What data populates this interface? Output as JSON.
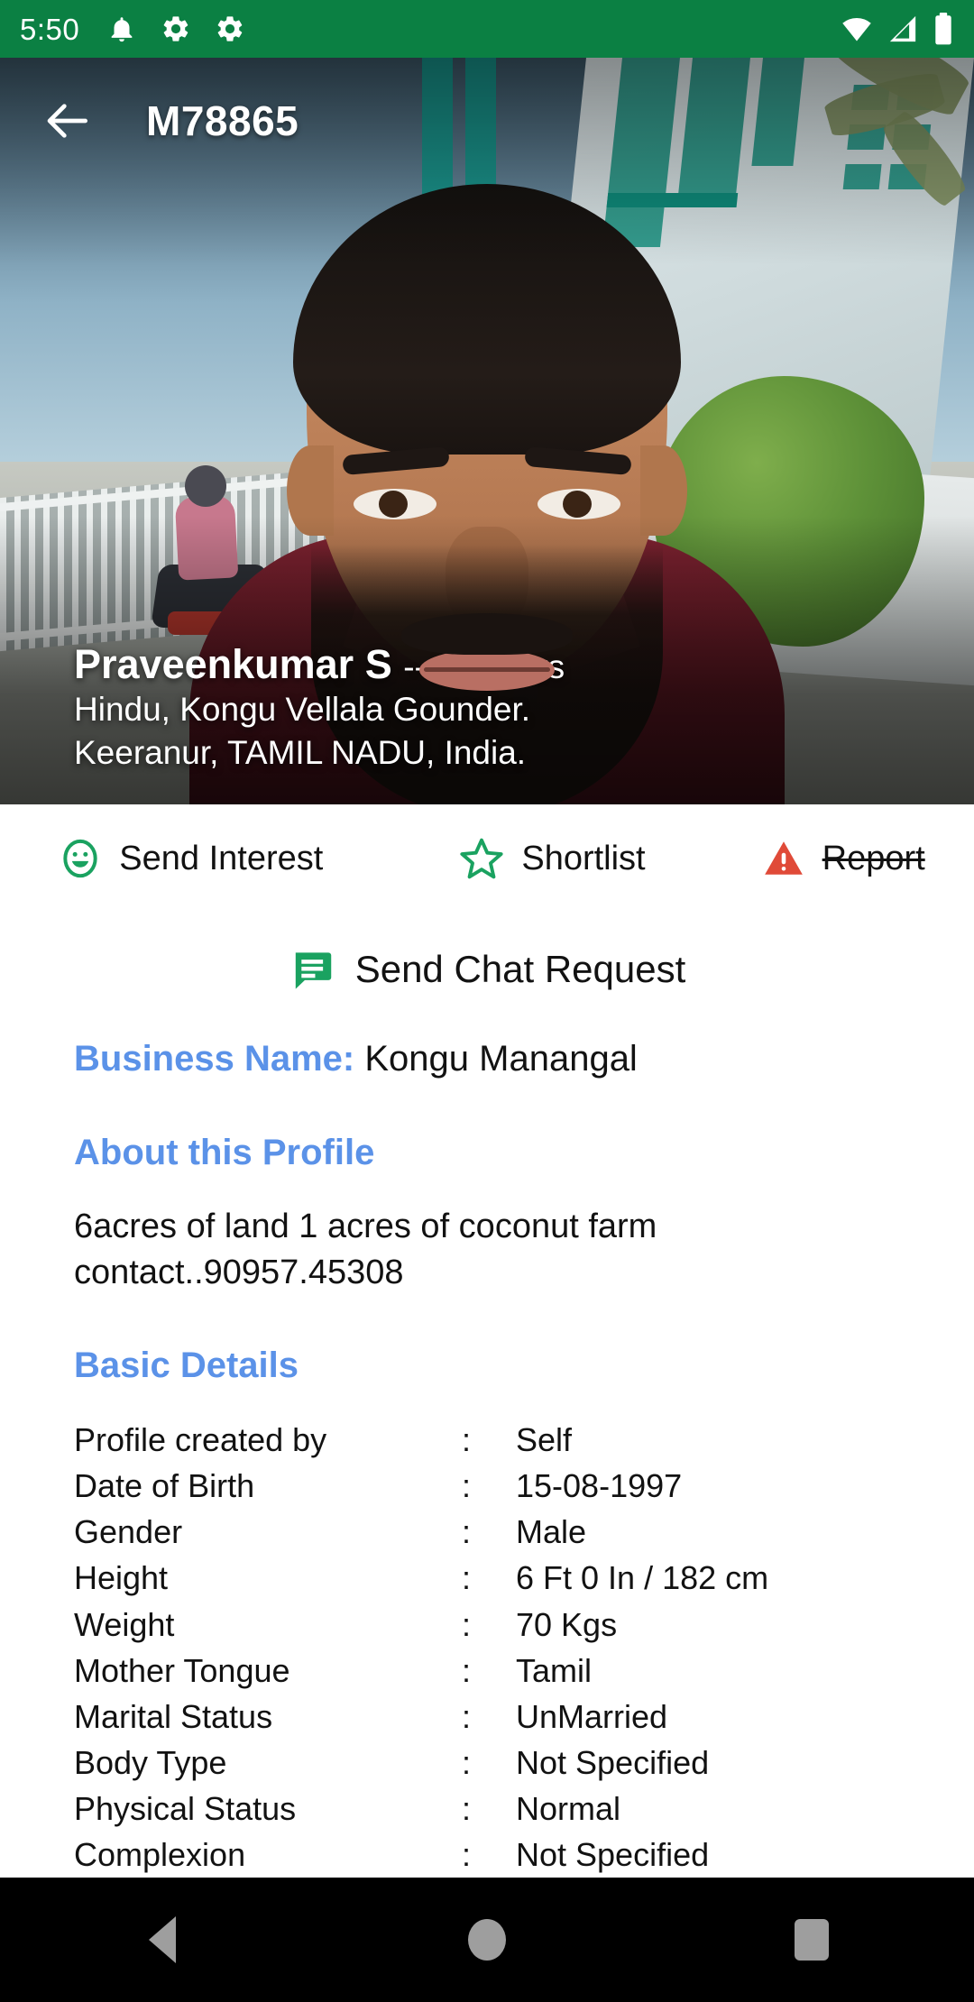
{
  "statusbar": {
    "time": "5:50",
    "left_icons": [
      "notification-bell-icon",
      "gear-icon",
      "gear-icon"
    ],
    "right_icons": [
      "wifi-icon",
      "cellular-signal-icon",
      "battery-icon"
    ],
    "background_color": "#0b8043"
  },
  "appbar": {
    "back_label": "back-arrow-icon",
    "title": "M78865"
  },
  "hero": {
    "name": "Praveenkumar S",
    "age": "-- 24 Years",
    "community": "Hindu, Kongu Vellala Gounder.",
    "location": "Keeranur, TAMIL NADU, India."
  },
  "actions": {
    "send_interest": "Send Interest",
    "shortlist": "Shortlist",
    "report": "Report",
    "send_chat_request": "Send Chat Request",
    "accent_green": "#1aa260",
    "report_red": "#e04a38"
  },
  "business": {
    "label": "Business Name:",
    "value": "Kongu Manangal"
  },
  "about": {
    "title": "About this Profile",
    "text": "6acres of land 1 acres of coconut farm contact..90957.45308"
  },
  "basic_details": {
    "title": "Basic Details",
    "separator": ":",
    "rows": [
      {
        "key": "Profile created by",
        "value": "Self"
      },
      {
        "key": "Date of Birth",
        "value": "15-08-1997"
      },
      {
        "key": "Gender",
        "value": "Male"
      },
      {
        "key": "Height",
        "value": "6 Ft 0 In / 182 cm"
      },
      {
        "key": "Weight",
        "value": "70 Kgs"
      },
      {
        "key": "Mother Tongue",
        "value": "Tamil"
      },
      {
        "key": "Marital Status",
        "value": "UnMarried"
      },
      {
        "key": "Body Type",
        "value": "Not Specified"
      },
      {
        "key": "Physical Status",
        "value": "Normal"
      },
      {
        "key": "Complexion",
        "value": "Not Specified"
      }
    ]
  },
  "navbar": {
    "back": "nav-back-icon",
    "home": "nav-home-icon",
    "recents": "nav-recents-icon"
  },
  "colors": {
    "heading_blue": "#5b92e8",
    "text_black": "#121212"
  }
}
